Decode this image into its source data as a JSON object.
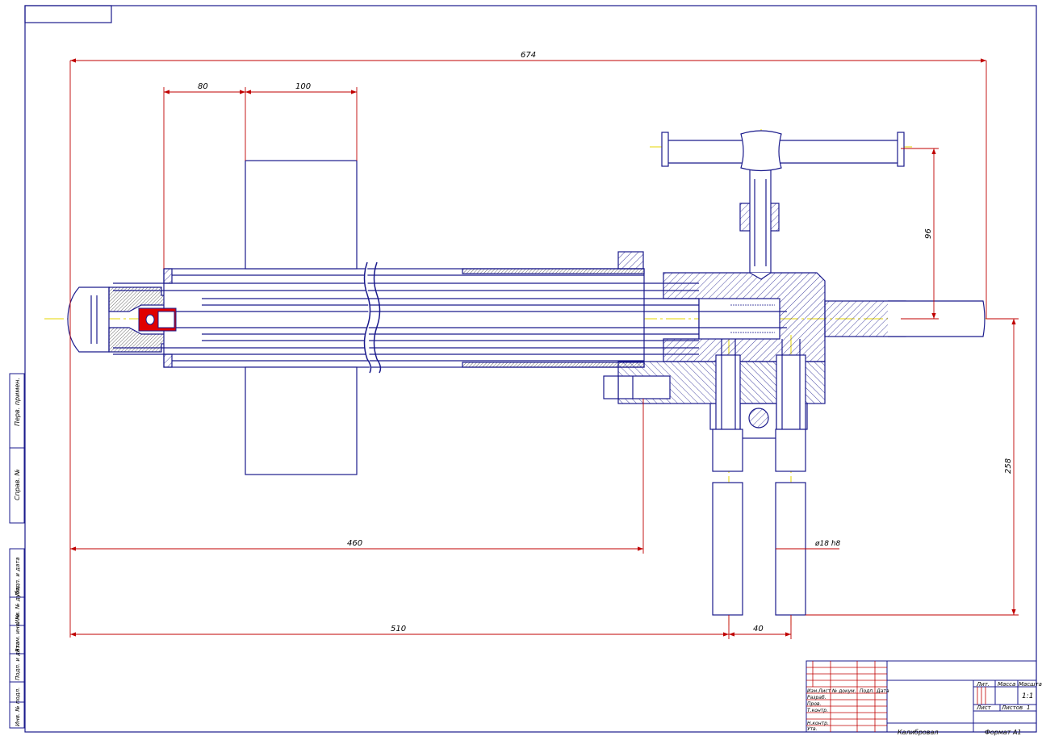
{
  "colors": {
    "outline": "#1a1a8c",
    "dimension": "#c00000",
    "centerline": "#e6d600",
    "hatch": "#1a1a8c",
    "highlight": "#e00000",
    "background": "#ffffff"
  },
  "dimensions": {
    "overall_length": "674",
    "sleeve_offset": "80",
    "disc_width": "100",
    "handle_height": "96",
    "leg_height": "258",
    "to_clamp": "460",
    "to_leg": "510",
    "leg_spacing": "40",
    "leg_diameter": "ø18 h8"
  },
  "title_block": {
    "title": "Калибровал",
    "format": "Формат А1",
    "scale": "1:1",
    "sheet_label": "Лист",
    "sheets_label": "Листов",
    "sheets_value": "1",
    "lit_label": "Лит.",
    "mass_label": "Масса",
    "scale_label": "Масштаб",
    "columns": [
      "Изм.",
      "Лист",
      "№ докум.",
      "Подп.",
      "Дата"
    ],
    "rows": [
      "Разраб.",
      "Пров.",
      "Т.контр.",
      "",
      "Н.контр.",
      "Утв."
    ]
  },
  "side_stamp": {
    "cells": [
      "Перв. примен.",
      "Справ. №",
      "Подп. и дата",
      "Инв. № дубл.",
      "Взам. инв. №",
      "Подп. и дата",
      "Инв. № подл."
    ]
  }
}
